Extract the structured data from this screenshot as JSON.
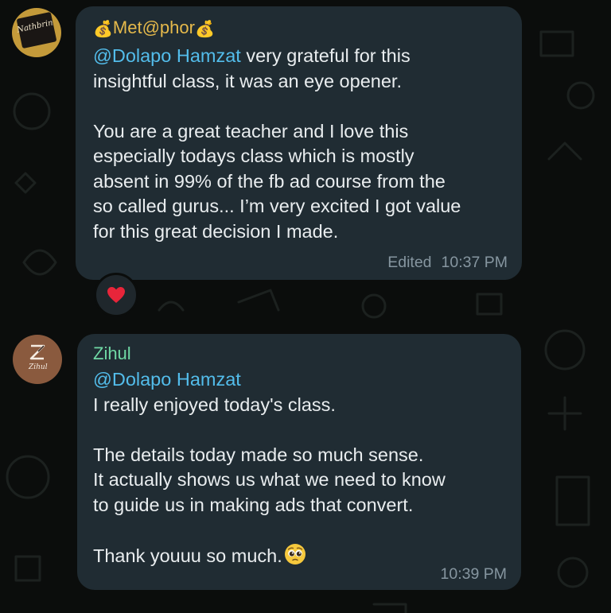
{
  "chat": {
    "messages": [
      {
        "sender": "Met@phor",
        "sender_decoration_icon": "money-bag-icon",
        "avatar_text": "Nathbrin",
        "mention": "@Dolapo Hamzat",
        "line1_rest": " very grateful for this",
        "line2": "insightful class, it was an eye opener.",
        "para2": [
          "You are a great teacher and I love this",
          "especially todays class which is mostly",
          "absent in 99% of the fb ad course from the",
          "so called gurus... I’m very excited I got value",
          "for this great decision I made."
        ],
        "edited_label": "Edited",
        "time": "10:37 PM",
        "reaction": "heart-icon"
      },
      {
        "sender": "Zihul",
        "avatar_text": "Zihul",
        "mention": "@Dolapo Hamzat",
        "line1": "I really enjoyed today's class.",
        "para2": [
          "The details today made so much sense.",
          "It actually shows us what we need to know",
          "to guide us in making ads that convert."
        ],
        "closing": "Thank youuu so much.",
        "closing_emoji": "pleading-face-icon",
        "time": "10:39 PM"
      }
    ]
  },
  "colors": {
    "background": "#0b0d0c",
    "bubble": "#202c33",
    "mention": "#53bdeb",
    "sender1": "#e5b94b",
    "sender2": "#6fd8a4",
    "meta": "#8696a0"
  }
}
